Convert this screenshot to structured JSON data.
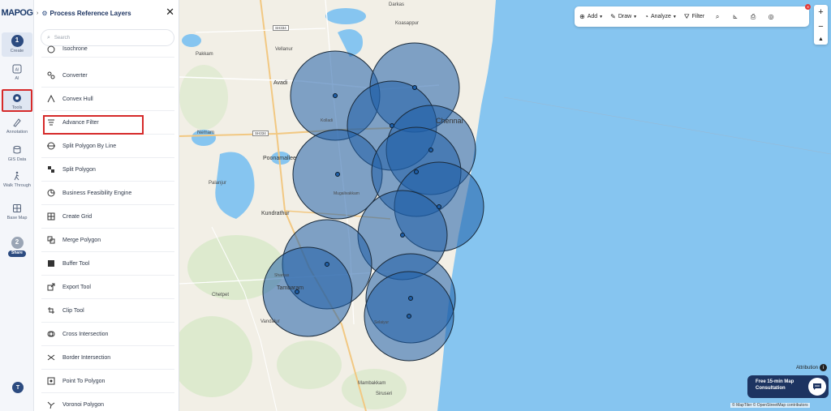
{
  "app": {
    "logo": "MAPOG"
  },
  "rail": {
    "create": {
      "number": "1",
      "label": "Create"
    },
    "ai": {
      "label": "AI"
    },
    "tools": {
      "label": "Tools"
    },
    "annotation": {
      "label": "Annotation"
    },
    "gis_data": {
      "label": "GIS Data"
    },
    "walk_through": {
      "label": "Walk Through"
    },
    "base_map": {
      "label": "Base Map"
    },
    "share": {
      "number": "2",
      "label": "Share"
    },
    "avatar": "T"
  },
  "panel": {
    "title": "Process Reference Layers",
    "search_placeholder": "Search",
    "tools": [
      "Isochrone",
      "Converter",
      "Convex Hull",
      "Advance Filter",
      "Split Polygon By Line",
      "Split Polygon",
      "Business Feasibility Engine",
      "Create Grid",
      "Merge Polygon",
      "Buffer Tool",
      "Export Tool",
      "Clip Tool",
      "Cross Intersection",
      "Border Intersection",
      "Point To Polygon",
      "Voronoi Polygon"
    ]
  },
  "toolbar": {
    "add": "Add",
    "draw": "Draw",
    "analyze": "Analyze",
    "filter": "Filter"
  },
  "map": {
    "places": {
      "darkas": "Darkas",
      "koasappur": "Koasappur",
      "pakkam": "Pakkam",
      "vellanur": "Vellanur",
      "avadi": "Avadi",
      "chennai": "Chennai",
      "nemam": "Nemam",
      "poonamallee": "Poonamallee",
      "palanjur": "Palanjur",
      "kundrathur": "Kundrathur",
      "chetpet": "Chetpet",
      "vandalur": "Vandalur",
      "tambaram": "Tambaram",
      "mambakkam": "Mambakkam",
      "siruseri": "Siruseri",
      "sharkas": "Sharkas",
      "kolladi": "Kolladi",
      "mugalivakkam": "Mugalivakkam",
      "selaiyur": "Selaiyur"
    },
    "shields": {
      "sh1": "SH334",
      "sh2": "SH334"
    },
    "colors": {
      "buffer_fill": "#1f5fa8",
      "sea": "#86c5f0",
      "land": "#f2efe6"
    }
  },
  "attribution": {
    "label": "Attribution"
  },
  "consultation": {
    "line1": "Free 15-min Map",
    "line2": "Consultation"
  },
  "credits": "© MapTiler © OpenStreetMap contributors"
}
